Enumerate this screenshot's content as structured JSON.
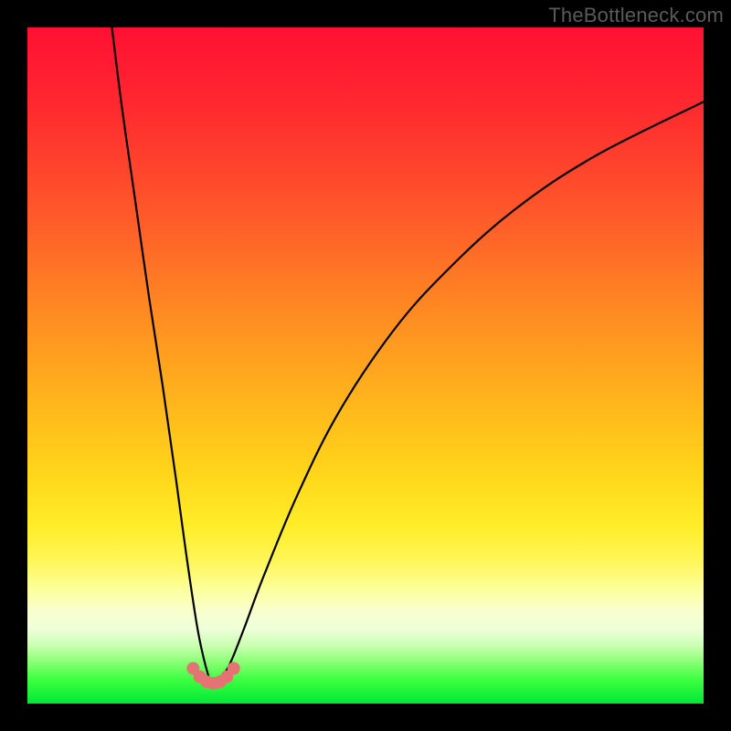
{
  "watermark": "TheBottleneck.com",
  "chart_data": {
    "type": "line",
    "title": "",
    "xlabel": "",
    "ylabel": "",
    "xlim": [
      0,
      100
    ],
    "ylim": [
      0,
      100
    ],
    "grid": false,
    "legend": "none",
    "background": "rainbow-gradient-vertical",
    "annotations": [
      {
        "name": "marker-dots",
        "color": "#e57373",
        "x_range": [
          24.5,
          30.5
        ],
        "y_approx": 95,
        "count": 7
      }
    ],
    "series": [
      {
        "name": "bottleneck-curve",
        "color": "#000000",
        "x": [
          12.5,
          14,
          16,
          18,
          20,
          22,
          23.5,
          25,
          26,
          27,
          27.7,
          28.5,
          30,
          32,
          35,
          40,
          46,
          54,
          62,
          72,
          84,
          100
        ],
        "values": [
          100,
          88,
          74,
          60,
          47,
          33,
          22,
          12,
          7,
          3.5,
          3,
          3.5,
          6,
          11,
          19,
          31,
          43,
          55,
          64,
          73,
          81,
          89
        ]
      }
    ]
  }
}
